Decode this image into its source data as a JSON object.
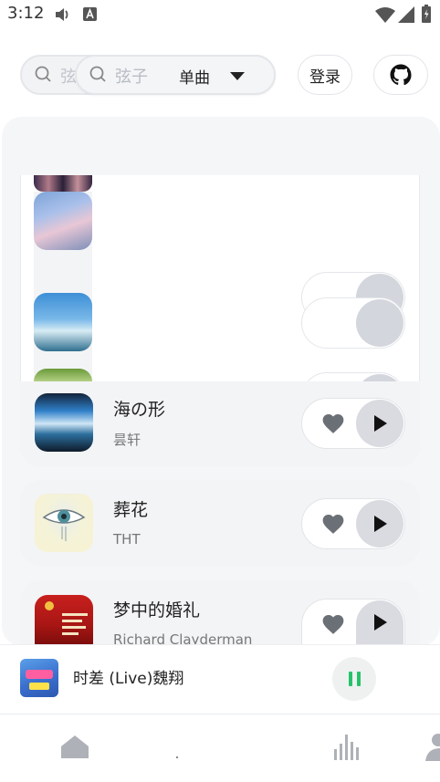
{
  "status_bar": {
    "time": "3:12"
  },
  "search": {
    "ghost_text": "弦",
    "query_text": "弦子",
    "type_label": "单曲"
  },
  "header": {
    "login_label": "登录"
  },
  "songs": [
    {
      "title": "海の形",
      "artist": "昙轩"
    },
    {
      "title": "葬花",
      "artist": "THT"
    },
    {
      "title": "梦中的婚礼",
      "artist": "Richard Clayderman"
    }
  ],
  "now_playing": {
    "title": "时差 (Live)魏翔"
  },
  "icons": {
    "volume": "volume-icon",
    "notification": "a-box-icon",
    "wifi": "wifi-icon",
    "signal": "signal-icon",
    "battery": "battery-icon",
    "search": "search-icon",
    "dropdown": "caret-down-icon",
    "github": "github-icon",
    "like": "heart-icon",
    "play": "play-icon",
    "pause": "pause-icon",
    "home": "home-icon",
    "chart": "bar-chart-icon",
    "user": "user-icon"
  },
  "colors": {
    "accent_green": "#25c26b",
    "panel_bg": "#f5f6f8",
    "card_bg": "#f3f4f6"
  }
}
